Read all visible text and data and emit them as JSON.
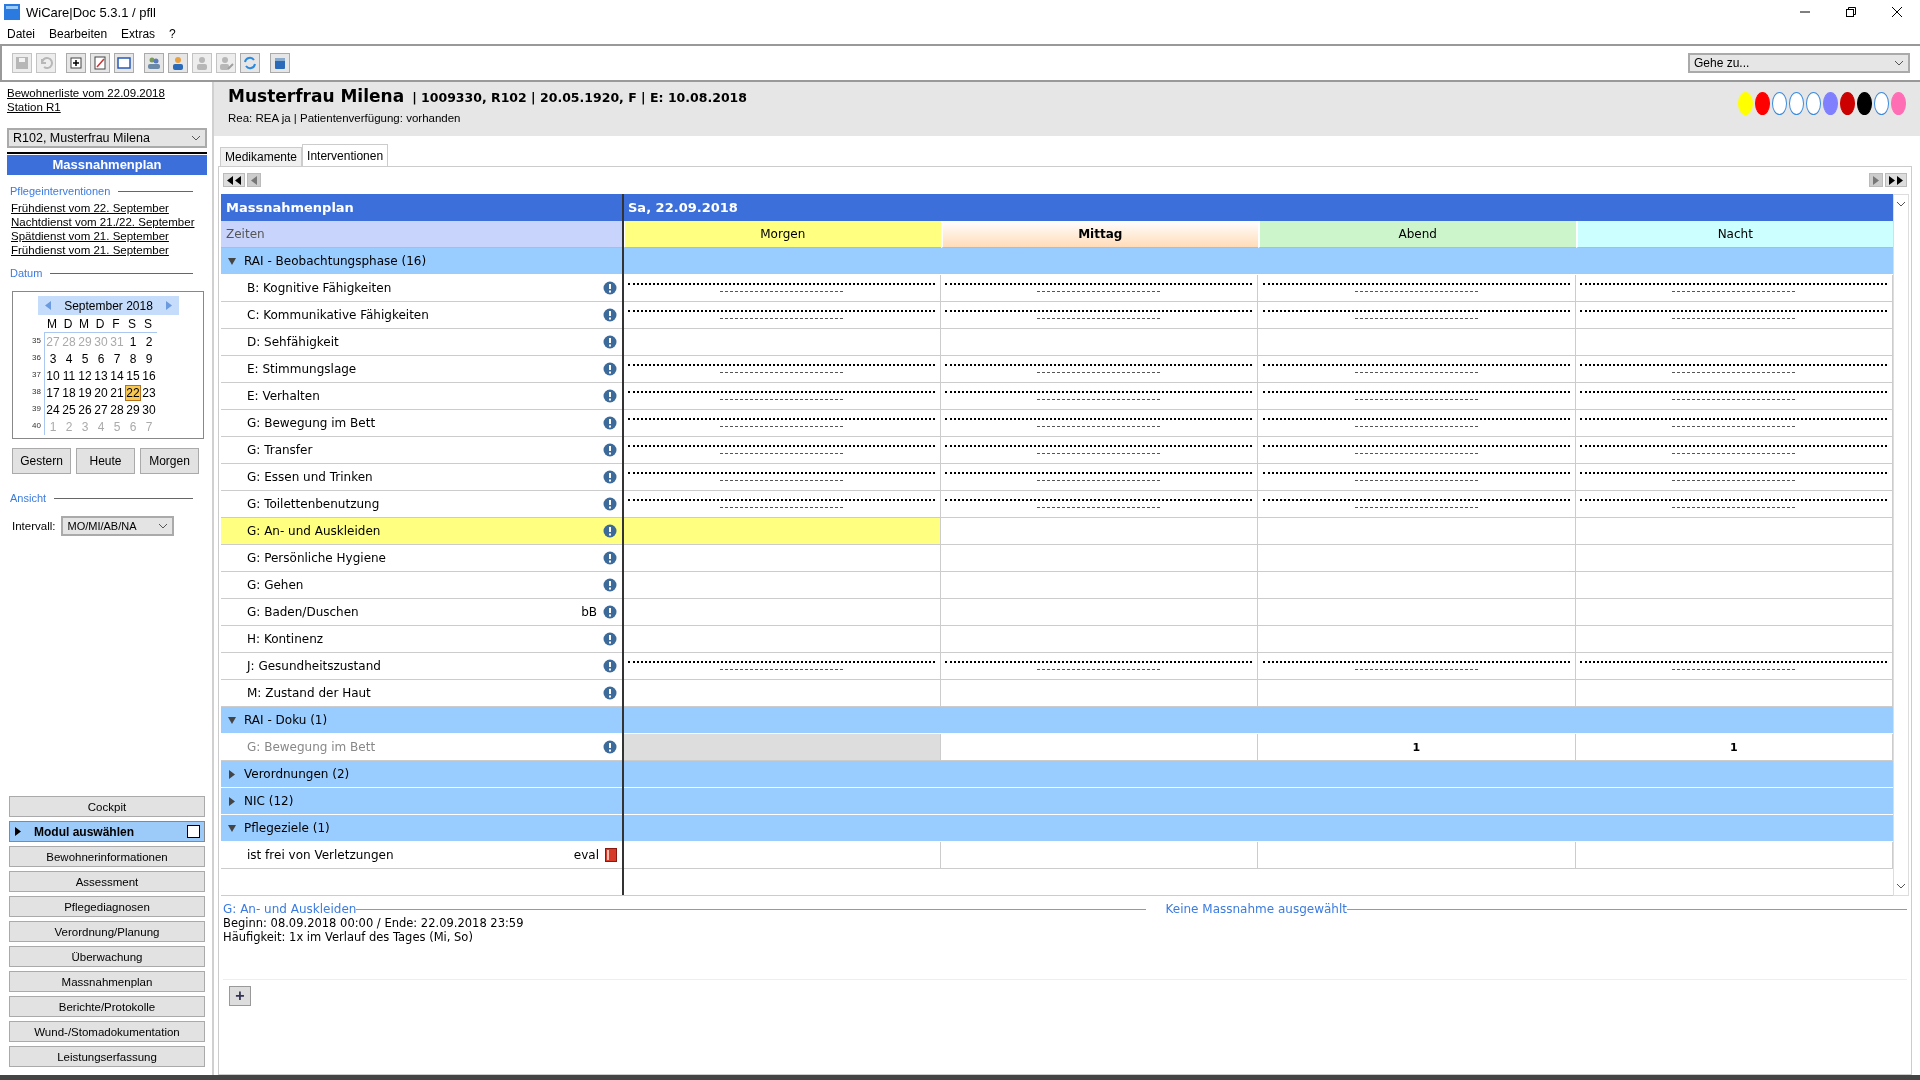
{
  "window": {
    "title": "WiCare|Doc 5.3.1  / pfll"
  },
  "menu": [
    "Datei",
    "Bearbeiten",
    "Extras",
    "?"
  ],
  "toolbar": [
    {
      "kind": "save",
      "disabled": true
    },
    {
      "kind": "undo",
      "disabled": true
    },
    {
      "kind": "add",
      "disabled": false
    },
    {
      "kind": "edit",
      "disabled": false
    },
    {
      "kind": "window",
      "disabled": false
    },
    {
      "kind": "group",
      "disabled": false
    },
    {
      "kind": "person",
      "disabled": false
    },
    {
      "kind": "person",
      "disabled": true
    },
    {
      "kind": "person-edit",
      "disabled": true
    },
    {
      "kind": "refresh",
      "disabled": false
    },
    {
      "kind": "box",
      "disabled": false
    }
  ],
  "goto": {
    "value": "Gehe zu..."
  },
  "sidebar": {
    "list_link": "Bewohnerliste vom 22.09.2018",
    "station_link": "Station R1",
    "resident": "R102, Musterfrau Milena",
    "section_title": "Massnahmenplan",
    "interventions_heading": "Pflegeinterventionen",
    "interventions": [
      "Frühdienst vom 22. September",
      "Nachtdienst vom 21./22. September",
      "Spätdienst vom 21. September",
      "Frühdienst vom 21. September"
    ],
    "date_heading": "Datum",
    "calendar": {
      "month": "September 2018",
      "weekdays": [
        "M",
        "D",
        "M",
        "D",
        "F",
        "S",
        "S"
      ],
      "weeks": [
        {
          "number": "35",
          "days": [
            {
              "label": "27",
              "muted": true,
              "selected": false
            },
            {
              "label": "28",
              "muted": true,
              "selected": false
            },
            {
              "label": "29",
              "muted": true,
              "selected": false
            },
            {
              "label": "30",
              "muted": true,
              "selected": false
            },
            {
              "label": "31",
              "muted": true,
              "selected": false
            },
            {
              "label": "1",
              "muted": false,
              "selected": false
            },
            {
              "label": "2",
              "muted": false,
              "selected": false
            }
          ]
        },
        {
          "number": "36",
          "days": [
            {
              "label": "3",
              "muted": false,
              "selected": false
            },
            {
              "label": "4",
              "muted": false,
              "selected": false
            },
            {
              "label": "5",
              "muted": false,
              "selected": false
            },
            {
              "label": "6",
              "muted": false,
              "selected": false
            },
            {
              "label": "7",
              "muted": false,
              "selected": false
            },
            {
              "label": "8",
              "muted": false,
              "selected": false
            },
            {
              "label": "9",
              "muted": false,
              "selected": false
            }
          ]
        },
        {
          "number": "37",
          "days": [
            {
              "label": "10",
              "muted": false,
              "selected": false
            },
            {
              "label": "11",
              "muted": false,
              "selected": false
            },
            {
              "label": "12",
              "muted": false,
              "selected": false
            },
            {
              "label": "13",
              "muted": false,
              "selected": false
            },
            {
              "label": "14",
              "muted": false,
              "selected": false
            },
            {
              "label": "15",
              "muted": false,
              "selected": false
            },
            {
              "label": "16",
              "muted": false,
              "selected": false
            }
          ]
        },
        {
          "number": "38",
          "days": [
            {
              "label": "17",
              "muted": false,
              "selected": false
            },
            {
              "label": "18",
              "muted": false,
              "selected": false
            },
            {
              "label": "19",
              "muted": false,
              "selected": false
            },
            {
              "label": "20",
              "muted": false,
              "selected": false
            },
            {
              "label": "21",
              "muted": false,
              "selected": false
            },
            {
              "label": "22",
              "muted": false,
              "selected": true
            },
            {
              "label": "23",
              "muted": false,
              "selected": false
            }
          ]
        },
        {
          "number": "39",
          "days": [
            {
              "label": "24",
              "muted": false,
              "selected": false
            },
            {
              "label": "25",
              "muted": false,
              "selected": false
            },
            {
              "label": "26",
              "muted": false,
              "selected": false
            },
            {
              "label": "27",
              "muted": false,
              "selected": false
            },
            {
              "label": "28",
              "muted": false,
              "selected": false
            },
            {
              "label": "29",
              "muted": false,
              "selected": false
            },
            {
              "label": "30",
              "muted": false,
              "selected": false
            }
          ]
        },
        {
          "number": "40",
          "days": [
            {
              "label": "1",
              "muted": true,
              "selected": false
            },
            {
              "label": "2",
              "muted": true,
              "selected": false
            },
            {
              "label": "3",
              "muted": true,
              "selected": false
            },
            {
              "label": "4",
              "muted": true,
              "selected": false
            },
            {
              "label": "5",
              "muted": true,
              "selected": false
            },
            {
              "label": "6",
              "muted": true,
              "selected": false
            },
            {
              "label": "7",
              "muted": true,
              "selected": false
            }
          ]
        }
      ]
    },
    "day_buttons": [
      "Gestern",
      "Heute",
      "Morgen"
    ],
    "view_heading": "Ansicht",
    "interval_label": "Intervall:",
    "interval_value": "MO/MI/AB/NA",
    "cockpit": "Cockpit",
    "module_selector": {
      "label": "Modul auswählen",
      "checked": false
    },
    "modules": [
      "Bewohnerinformationen",
      "Assessment",
      "Pflegediagnosen",
      "Verordnung/Planung",
      "Überwachung",
      "Massnahmenplan",
      "Berichte/Protokolle",
      "Wund-/Stomadokumentation",
      "Leistungserfassung"
    ]
  },
  "patient": {
    "name": "Musterfrau Milena",
    "details": "| 1009330, R102 | 20.05.1920, F | E: 10.08.2018",
    "info": "Rea: REA ja | Patientenverfügung: vorhanden",
    "markers": [
      {
        "color": "#ffff00"
      },
      {
        "color": "#ff0000"
      },
      {
        "color": "#ffffff"
      },
      {
        "color": "#ffffff"
      },
      {
        "color": "#ffffff"
      },
      {
        "color": "#8080ff"
      },
      {
        "color": "#cc0000"
      },
      {
        "color": "#000000"
      },
      {
        "color": "#ffffff"
      },
      {
        "color": "#ff6eb4"
      }
    ]
  },
  "tabs": [
    {
      "label": "Medikamente",
      "selected": false
    },
    {
      "label": "Interventionen",
      "selected": true
    }
  ],
  "plan": {
    "title": "Massnahmenplan",
    "date": "Sa, 22.09.2018",
    "times_label": "Zeiten",
    "columns": [
      {
        "label": "Morgen",
        "color": "#ffff80",
        "current": false
      },
      {
        "label": "Mittag",
        "color": "#ffdcb8",
        "current": true
      },
      {
        "label": "Abend",
        "color": "#ccf5cc",
        "current": false
      },
      {
        "label": "Nacht",
        "color": "#ccffff",
        "current": false
      }
    ],
    "groups": [
      {
        "label": "RAI - Beobachtungsphase (16)",
        "expanded": true,
        "rows": [
          {
            "label": "B: Kognitive Fähigkeiten",
            "kind": "info",
            "scheduled": true,
            "selected": false,
            "disabled": false
          },
          {
            "label": "C: Kommunikative Fähigkeiten",
            "kind": "info",
            "scheduled": true,
            "selected": false,
            "disabled": false
          },
          {
            "label": "D: Sehfähigkeit",
            "kind": "info",
            "scheduled": false,
            "selected": false,
            "disabled": false
          },
          {
            "label": "E: Stimmungslage",
            "kind": "info",
            "scheduled": true,
            "selected": false,
            "disabled": false
          },
          {
            "label": "E: Verhalten",
            "kind": "info",
            "scheduled": true,
            "selected": false,
            "disabled": false
          },
          {
            "label": "G: Bewegung im Bett",
            "kind": "info",
            "scheduled": true,
            "selected": false,
            "disabled": false
          },
          {
            "label": "G: Transfer",
            "kind": "info",
            "scheduled": true,
            "selected": false,
            "disabled": false
          },
          {
            "label": "G: Essen und Trinken",
            "kind": "info",
            "scheduled": true,
            "selected": false,
            "disabled": false
          },
          {
            "label": "G: Toilettenbenutzung",
            "kind": "info",
            "scheduled": true,
            "selected": false,
            "disabled": false
          },
          {
            "label": "G: An- und Auskleiden",
            "kind": "info",
            "scheduled": false,
            "selected": true,
            "disabled": false
          },
          {
            "label": "G: Persönliche Hygiene",
            "kind": "info",
            "scheduled": false,
            "selected": false,
            "disabled": false
          },
          {
            "label": "G: Gehen",
            "kind": "info",
            "scheduled": false,
            "selected": false,
            "disabled": false
          },
          {
            "label": "G: Baden/Duschen",
            "suffix": "bB",
            "kind": "info",
            "scheduled": false,
            "selected": false,
            "disabled": false
          },
          {
            "label": "H: Kontinenz",
            "kind": "info",
            "scheduled": false,
            "selected": false,
            "disabled": false
          },
          {
            "label": "J: Gesundheitszustand",
            "kind": "info",
            "scheduled": true,
            "selected": false,
            "disabled": false
          },
          {
            "label": "M: Zustand der Haut",
            "kind": "info",
            "scheduled": false,
            "selected": false,
            "disabled": false
          }
        ]
      },
      {
        "label": "RAI - Doku (1)",
        "expanded": true,
        "rows": [
          {
            "label": "G: Bewegung im Bett",
            "kind": "info",
            "scheduled": false,
            "selected": false,
            "disabled": true,
            "cells": [
              {
                "shaded": true
              },
              {
                "shaded": false
              },
              {
                "shaded": false,
                "text": "1"
              },
              {
                "shaded": false,
                "text": "1"
              }
            ]
          }
        ]
      },
      {
        "label": "Verordnungen (2)",
        "expanded": false
      },
      {
        "label": "NIC (12)",
        "expanded": false
      },
      {
        "label": "Pflegeziele (1)",
        "expanded": true,
        "rows": [
          {
            "label": "ist frei von Verletzungen",
            "suffix": "eval",
            "kind": "book",
            "scheduled": false,
            "selected": false,
            "disabled": false
          }
        ]
      }
    ]
  },
  "details": {
    "heading": "G: An- und Auskleiden",
    "lines": [
      "Beginn: 08.09.2018 00:00 / Ende: 22.09.2018 23:59",
      "Häufigkeit: 1x im Verlauf des Tages (Mi, So)"
    ],
    "side_heading": "Keine Massnahme ausgewählt",
    "add_label": "+"
  }
}
